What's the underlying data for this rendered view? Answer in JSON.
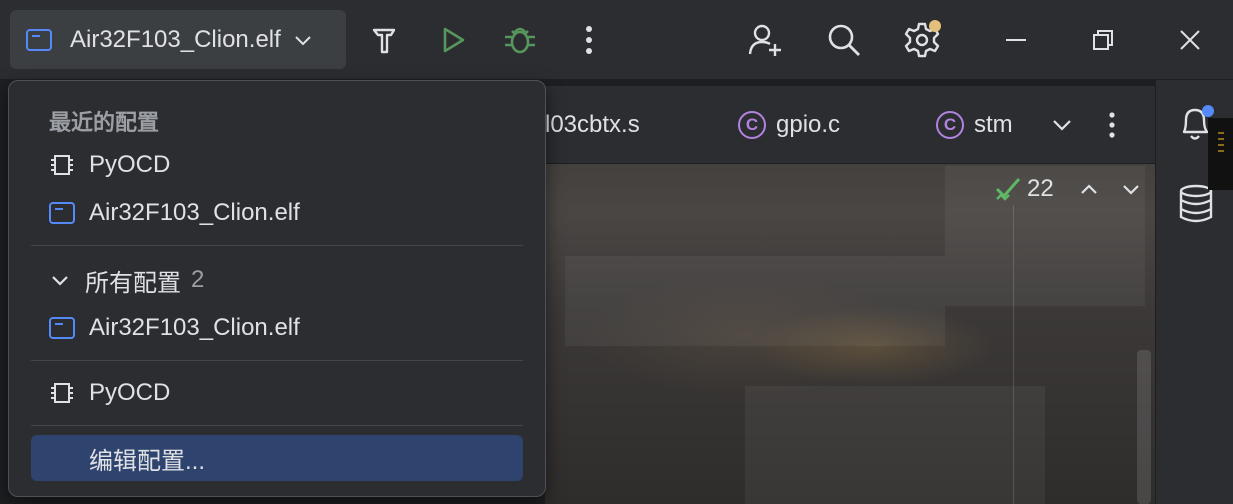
{
  "toolbar": {
    "run_config_label": "Air32F103_Clion.elf",
    "build_icon": "hammer-icon",
    "run_icon": "run-icon",
    "debug_icon": "debug-icon",
    "more_icon": "more-vertical-icon",
    "add_user_icon": "add-user-icon",
    "search_icon": "search-icon",
    "settings_icon": "gear-icon",
    "minimize_icon": "minimize-icon",
    "restore_icon": "restore-icon",
    "close_icon": "close-icon",
    "accent": "#57965c",
    "settings_badge": "#e5c07b"
  },
  "tabs": [
    {
      "label": "l03cbtx.s",
      "icon": null
    },
    {
      "label": "gpio.c",
      "icon": "c-file-icon"
    },
    {
      "label": "stm",
      "icon": "c-file-icon"
    }
  ],
  "tab_actions": {
    "overflow_icon": "chevron-down-icon",
    "more_icon": "more-vertical-icon"
  },
  "inspections": {
    "count": "22",
    "up_icon": "chevron-up-icon",
    "down_icon": "chevron-down-icon",
    "status_color": "#5fb865"
  },
  "right_toolbar": {
    "notifications_icon": "bell-icon",
    "database_icon": "database-icon",
    "notification_badge": "#548af7"
  },
  "dropdown": {
    "recent_title": "最近的配置",
    "recent_items": [
      {
        "label": "PyOCD",
        "icon": "chip-icon"
      },
      {
        "label": "Air32F103_Clion.elf",
        "icon": "app-config-icon"
      }
    ],
    "all_title": "所有配置",
    "all_count": "2",
    "all_items": [
      {
        "label": "Air32F103_Clion.elf",
        "icon": "app-config-icon"
      }
    ],
    "other_items": [
      {
        "label": "PyOCD",
        "icon": "chip-icon"
      }
    ],
    "edit_label": "编辑配置...",
    "selected_bg": "#2e436e"
  }
}
